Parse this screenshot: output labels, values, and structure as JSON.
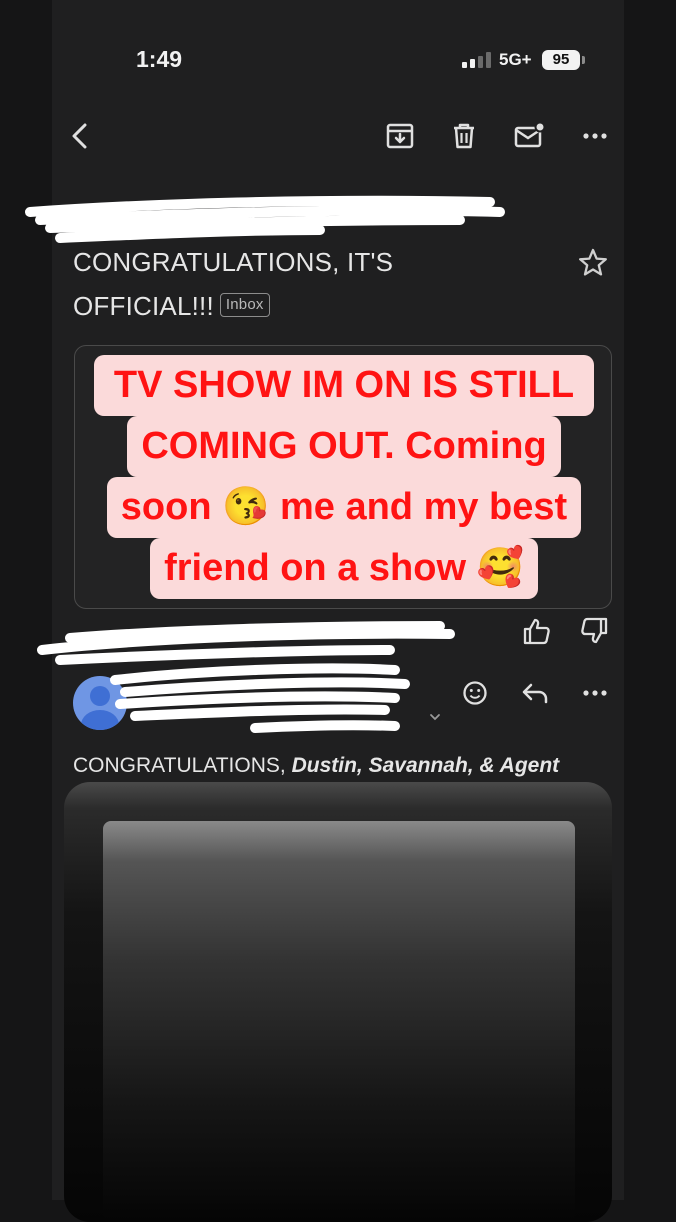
{
  "status_bar": {
    "time": "1:49",
    "network": "5G+",
    "battery": "95"
  },
  "toolbar": {
    "back_icon": "chevron-left-icon",
    "archive_icon": "archive-icon",
    "delete_icon": "trash-icon",
    "mark_unread_icon": "mail-unread-icon",
    "more_icon": "more-horizontal-icon"
  },
  "email": {
    "subject_line1": "CONGRATULATIONS, IT'S",
    "subject_line2": "OFFICIAL!!!",
    "label": "Inbox",
    "greeting_prefix": "CONGRATULATIONS,",
    "greeting_names": "Dustin, Savannah, & Agent"
  },
  "overlay": {
    "line1": "TV SHOW IM ON IS STILL",
    "line2": "COMING OUT. Coming",
    "line3": "soon 😘 me and my best",
    "line4": "friend on a show 🥰"
  },
  "colors": {
    "background": "#151516",
    "overlay_text": "#ff1313",
    "overlay_bg": "#fbdada",
    "avatar": "#6f96e4"
  }
}
